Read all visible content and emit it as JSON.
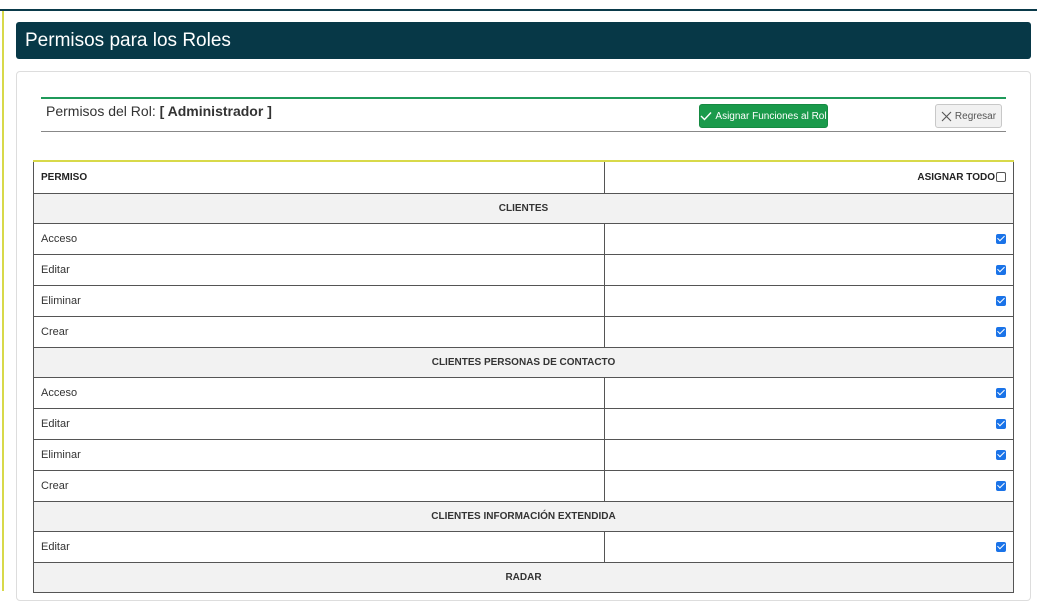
{
  "page": {
    "title": "Permisos para los Roles"
  },
  "toolbar": {
    "role_prefix": "Permisos del Rol:",
    "role_name": "[ Administrador ]",
    "assign_button": "Asignar Funciones al Rol",
    "back_button": "Regresar"
  },
  "table": {
    "col_permiso": "PERMISO",
    "col_asignar": "ASIGNAR TODO",
    "assign_all_checked": false,
    "sections": [
      {
        "name": "CLIENTES",
        "rows": [
          {
            "label": "Acceso",
            "checked": true
          },
          {
            "label": "Editar",
            "checked": true
          },
          {
            "label": "Eliminar",
            "checked": true
          },
          {
            "label": "Crear",
            "checked": true
          }
        ]
      },
      {
        "name": "CLIENTES PERSONAS DE CONTACTO",
        "rows": [
          {
            "label": "Acceso",
            "checked": true
          },
          {
            "label": "Editar",
            "checked": true
          },
          {
            "label": "Eliminar",
            "checked": true
          },
          {
            "label": "Crear",
            "checked": true
          }
        ]
      },
      {
        "name": "CLIENTES INFORMACIÓN EXTENDIDA",
        "rows": [
          {
            "label": "Editar",
            "checked": true
          }
        ]
      },
      {
        "name": "RADAR",
        "rows": []
      }
    ]
  },
  "colors": {
    "header_bg": "#073847",
    "assign_btn": "#1a9a4b",
    "accent_line": "#d8d94a"
  }
}
